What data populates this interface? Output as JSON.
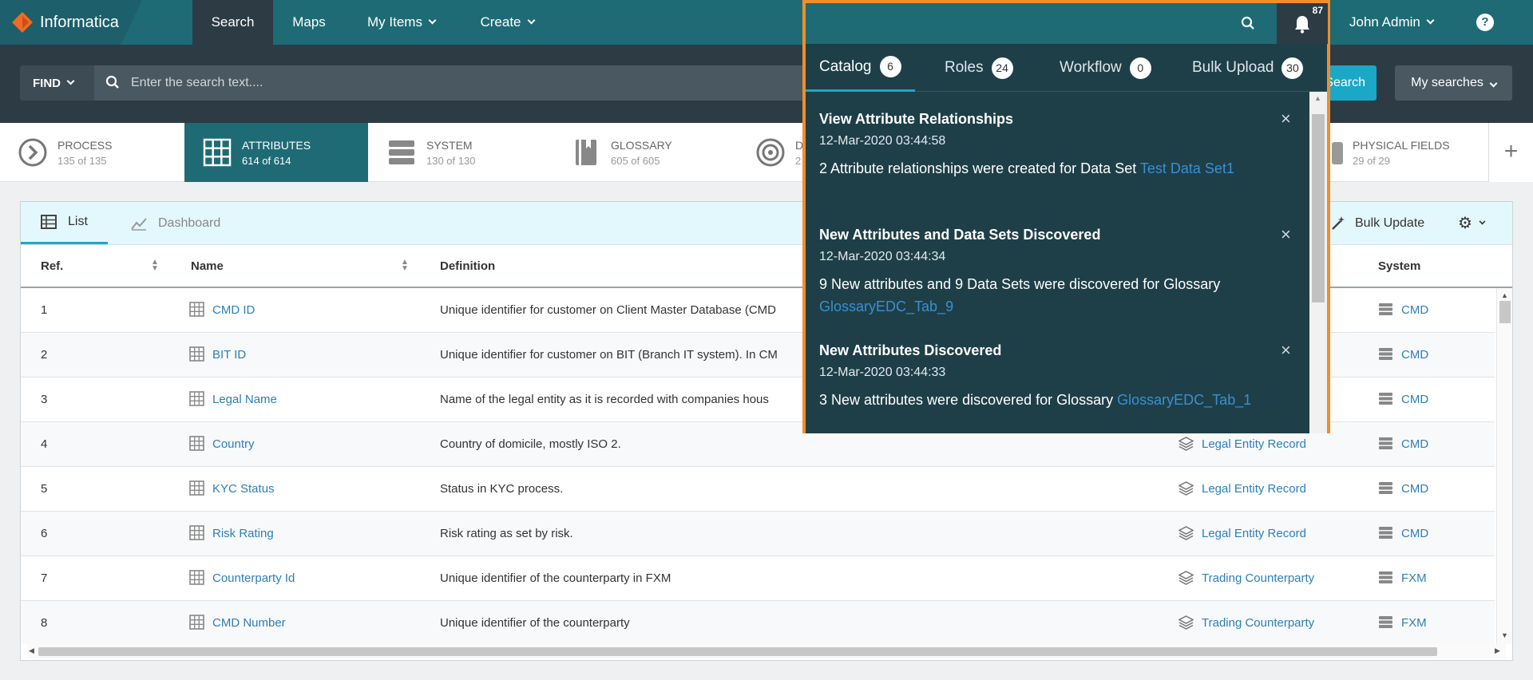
{
  "brand": "Informatica",
  "nav": {
    "search": "Search",
    "maps": "Maps",
    "my_items": "My Items",
    "create": "Create"
  },
  "user": "John Admin",
  "find": {
    "button": "FIND",
    "placeholder": "Enter the search text....",
    "search_button": "Search",
    "my_searches": "My searches"
  },
  "categories": [
    {
      "label": "PROCESS",
      "count": "135 of 135",
      "icon": "process-chevron-icon"
    },
    {
      "label": "ATTRIBUTES",
      "count": "614 of 614",
      "icon": "grid-table-icon"
    },
    {
      "label": "SYSTEM",
      "count": "130 of 130",
      "icon": "server-stack-icon"
    },
    {
      "label": "GLOSSARY",
      "count": "605 of 605",
      "icon": "book-icon"
    },
    {
      "label": "D",
      "count": "2",
      "icon": "target-icon"
    },
    {
      "label": "PHYSICAL FIELDS",
      "count": "29 of 29",
      "icon": "cylinder-icon"
    }
  ],
  "view_tabs": {
    "list": "List",
    "dashboard": "Dashboard"
  },
  "bulk_update": "Bulk Update",
  "table": {
    "headers": {
      "ref": "Ref.",
      "name": "Name",
      "definition": "Definition",
      "system": "System"
    },
    "rows": [
      {
        "ref": "1",
        "name": "CMD ID",
        "definition": "Unique identifier for customer on Client Master Database (CMD",
        "data_set": "",
        "system": "CMD"
      },
      {
        "ref": "2",
        "name": "BIT ID",
        "definition": "Unique identifier for customer on BIT (Branch IT system). In CM",
        "data_set": "",
        "system": "CMD"
      },
      {
        "ref": "3",
        "name": "Legal Name",
        "definition": "Name of the legal entity as it is recorded with companies hous",
        "data_set": "",
        "system": "CMD"
      },
      {
        "ref": "4",
        "name": "Country",
        "definition": "Country of domicile, mostly ISO 2.",
        "data_set": "Legal Entity Record",
        "system": "CMD"
      },
      {
        "ref": "5",
        "name": "KYC Status",
        "definition": "Status in KYC process.",
        "data_set": "Legal Entity Record",
        "system": "CMD"
      },
      {
        "ref": "6",
        "name": "Risk Rating",
        "definition": "Risk rating as set by risk.",
        "data_set": "Legal Entity Record",
        "system": "CMD"
      },
      {
        "ref": "7",
        "name": "Counterparty Id",
        "definition": "Unique identifier of the counterparty in FXM",
        "data_set": "Trading Counterparty",
        "system": "FXM"
      },
      {
        "ref": "8",
        "name": "CMD Number",
        "definition": "Unique identifier of the counterparty",
        "data_set": "Trading Counterparty",
        "system": "FXM"
      }
    ]
  },
  "notifications": {
    "bell_count": "87",
    "tabs": [
      {
        "label": "Catalog",
        "count": "6"
      },
      {
        "label": "Roles",
        "count": "24"
      },
      {
        "label": "Workflow",
        "count": "0"
      },
      {
        "label": "Bulk Upload",
        "count": "30"
      }
    ],
    "items": [
      {
        "title": "View Attribute Relationships",
        "date": "12-Mar-2020 03:44:58",
        "body": "2 Attribute relationships were created for Data Set ",
        "link": "Test Data Set1"
      },
      {
        "title": "New Attributes and Data Sets Discovered",
        "date": "12-Mar-2020 03:44:34",
        "body": "9 New attributes and 9 Data Sets were discovered for Glossary ",
        "link": "GlossaryEDC_Tab_9"
      },
      {
        "title": "New Attributes Discovered",
        "date": "12-Mar-2020 03:44:33",
        "body": "3 New attributes were discovered for Glossary ",
        "link": "GlossaryEDC_Tab_1"
      }
    ]
  },
  "colors": {
    "header": "#1e6b75",
    "dark_bar": "#2d3b45",
    "accent": "#1ba8c7",
    "popup_bg": "#1e3f48",
    "popup_border": "#f28d2a",
    "link": "#2d7fb8"
  }
}
